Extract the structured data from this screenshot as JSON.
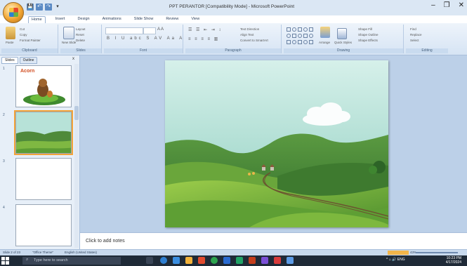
{
  "window": {
    "title": "PPT PERANTOR [Compatibility Mode] - Microsoft PowerPoint",
    "controls": [
      "–",
      "❐",
      "✕"
    ]
  },
  "qat": [
    "💾",
    "↶",
    "↷",
    "▾"
  ],
  "ribbon": {
    "tabs": [
      "Home",
      "Insert",
      "Design",
      "Animations",
      "Slide Show",
      "Review",
      "View"
    ],
    "active_tab": "Home",
    "groups": {
      "clipboard": {
        "label": "Clipboard",
        "paste": "Paste",
        "cut": "Cut",
        "copy": "Copy",
        "format_painter": "Format Painter"
      },
      "slides": {
        "label": "Slides",
        "new_slide": "New Slide",
        "layout": "Layout",
        "reset": "Reset",
        "delete": "Delete"
      },
      "font": {
        "label": "Font"
      },
      "paragraph": {
        "label": "Paragraph",
        "text_direction": "Text Direction",
        "align_text": "Align Text",
        "convert": "Convert to SmartArt"
      },
      "drawing": {
        "label": "Drawing",
        "arrange": "Arrange",
        "quick_styles": "Quick Styles",
        "shape_fill": "Shape Fill",
        "shape_outline": "Shape Outline",
        "shape_effects": "Shape Effects"
      },
      "editing": {
        "label": "Editing",
        "find": "Find",
        "replace": "Replace",
        "select": "Select"
      }
    }
  },
  "left_pane": {
    "tabs": [
      "Slides",
      "Outline"
    ],
    "close": "x",
    "slide_numbers": [
      "1",
      "2",
      "3",
      "4"
    ],
    "slide1_title": "Acorn"
  },
  "notes": {
    "placeholder": "Click to add notes"
  },
  "status": {
    "slide_count": "Slide 2 of 23",
    "theme": "\"Office Theme\"",
    "language": "English (United States)",
    "zoom": "43%"
  },
  "taskbar": {
    "search_placeholder": "Type here to search",
    "tray": "^  ⌂  🔊  ENG",
    "time": "10:23 PM",
    "date": "4/17/2024"
  },
  "colors": {
    "sky_top": "#cdebe6",
    "sky_bottom": "#8fcfc0",
    "hill_dark": "#3d7a34",
    "hill_light": "#8cc63f",
    "selected_thumb": "#f3a43a",
    "ribbon_bg": "#dbe7f4"
  }
}
